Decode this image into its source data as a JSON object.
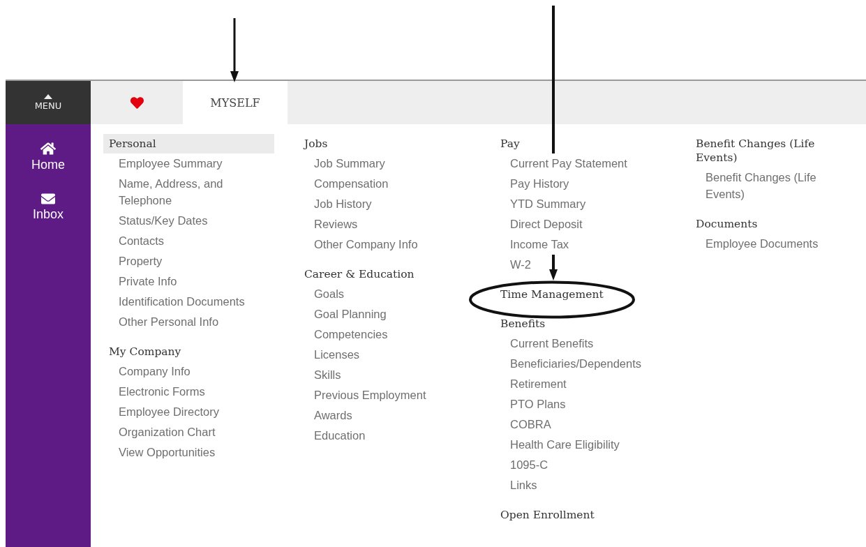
{
  "sidebar": {
    "menu_label": "MENU",
    "items": [
      {
        "kind": "home",
        "label": "Home"
      },
      {
        "kind": "inbox",
        "label": "Inbox"
      }
    ]
  },
  "tabs": [
    {
      "kind": "favorites",
      "selected": false
    },
    {
      "kind": "text",
      "label": "MYSELF",
      "selected": true
    }
  ],
  "columns": [
    {
      "sections": [
        {
          "heading": "Personal",
          "selected": true,
          "items": [
            "Employee Summary",
            "Name, Address, and Telephone",
            "Status/Key Dates",
            "Contacts",
            "Property",
            "Private Info",
            "Identification Documents",
            "Other Personal Info"
          ]
        },
        {
          "heading": "My Company",
          "selected": false,
          "items": [
            "Company Info",
            "Electronic Forms",
            "Employee Directory",
            "Organization Chart",
            "View Opportunities"
          ]
        }
      ]
    },
    {
      "sections": [
        {
          "heading": "Jobs",
          "selected": false,
          "items": [
            "Job Summary",
            "Compensation",
            "Job History",
            "Reviews",
            "Other Company Info"
          ]
        },
        {
          "heading": "Career & Education",
          "selected": false,
          "items": [
            "Goals",
            "Goal Planning",
            "Competencies",
            "Licenses",
            "Skills",
            "Previous Employment",
            "Awards",
            "Education"
          ]
        }
      ]
    },
    {
      "sections": [
        {
          "heading": "Pay",
          "selected": false,
          "items": [
            "Current Pay Statement",
            "Pay History",
            "YTD Summary",
            "Direct Deposit",
            "Income Tax",
            "W-2"
          ]
        },
        {
          "heading": "Time Management",
          "selected": false,
          "circled": true
        },
        {
          "heading": "Benefits",
          "selected": false,
          "items": [
            "Current Benefits",
            "Beneficiaries/Dependents",
            "Retirement",
            "PTO Plans",
            "COBRA",
            "Health Care Eligibility",
            "1095-C",
            "Links"
          ]
        },
        {
          "heading": "Open Enrollment",
          "selected": false
        }
      ]
    },
    {
      "sections": [
        {
          "heading": "Benefit Changes (Life Events)",
          "selected": false,
          "items": [
            "Benefit Changes (Life Events)"
          ]
        },
        {
          "heading": "Documents",
          "selected": false,
          "items": [
            "Employee Documents"
          ]
        }
      ]
    }
  ]
}
